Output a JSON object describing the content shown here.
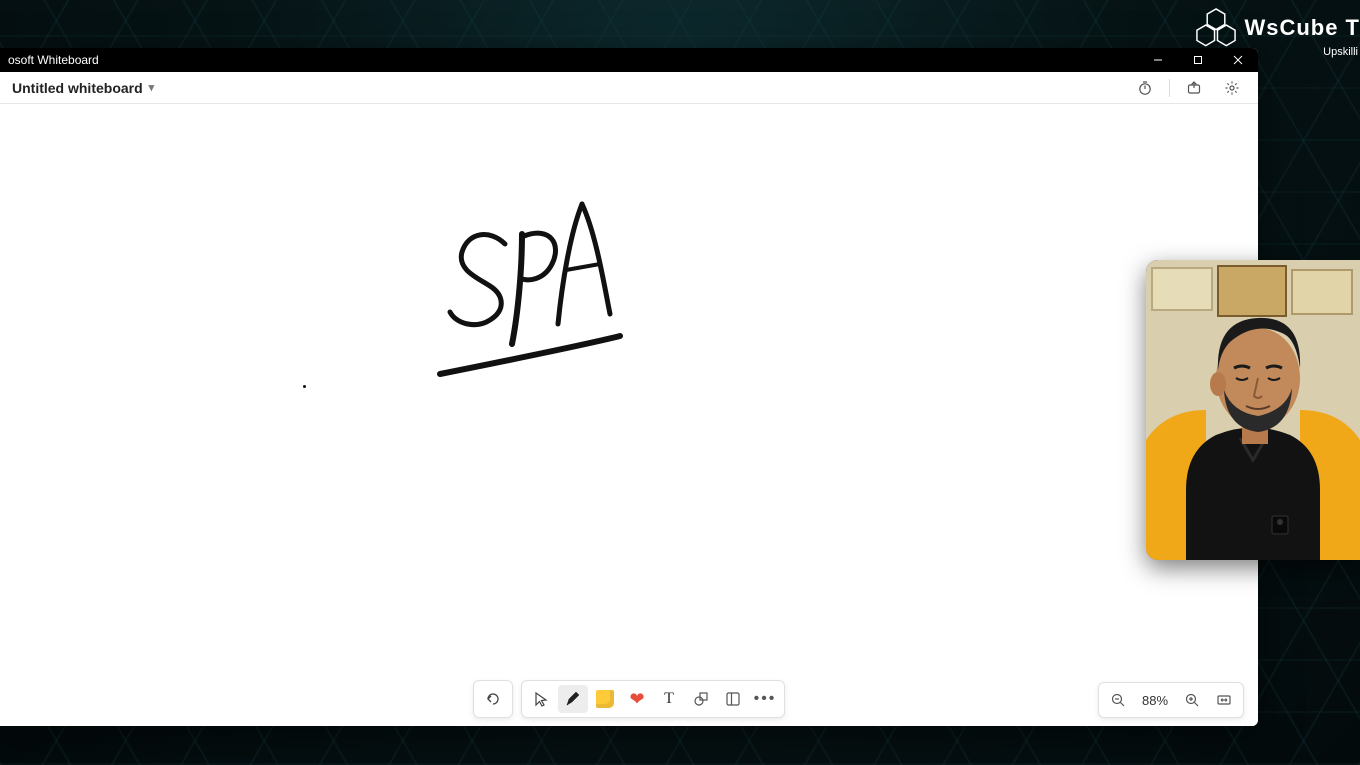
{
  "app": {
    "title": "osoft Whiteboard",
    "board_name": "Untitled whiteboard"
  },
  "header_icons": {
    "timer": "timer-icon",
    "share": "share-icon",
    "settings": "gear-icon"
  },
  "canvas": {
    "handwriting": "SPA"
  },
  "toolbar": {
    "undo": "undo",
    "select": "select",
    "ink": "ink",
    "note": "sticky-note",
    "reaction": "heart",
    "text_label": "T",
    "shapes": "shapes",
    "templates": "templates",
    "more": "more"
  },
  "zoom": {
    "level": "88%"
  },
  "watermark": {
    "brand": "WsCube T",
    "tagline": "Upskilli"
  }
}
